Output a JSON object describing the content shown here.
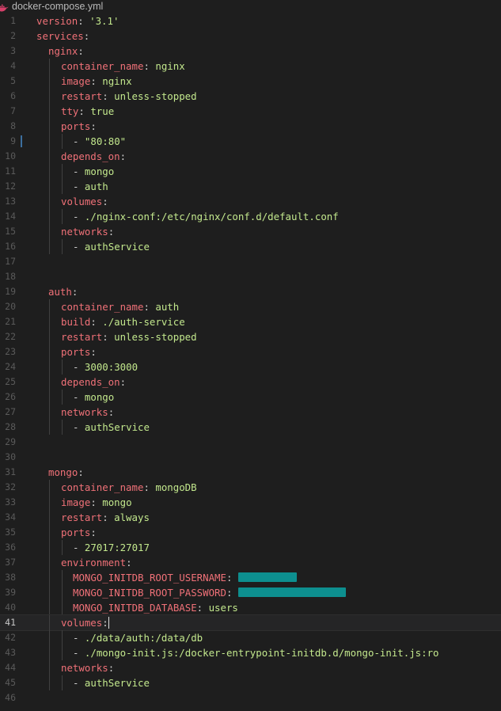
{
  "tab": {
    "filename": "docker-compose.yml",
    "icon": "docker-whale-icon"
  },
  "colors": {
    "key": "#f07178",
    "value": "#c3e88d",
    "redaction": "#0d8f8f",
    "background": "#1e1e1e"
  },
  "editor": {
    "current_line": 41,
    "modified_line": 9
  },
  "lines": [
    {
      "n": "1",
      "indent": 0,
      "key": "version",
      "sep": ": ",
      "val": "'3.1'"
    },
    {
      "n": "2",
      "indent": 0,
      "key": "services",
      "sep": ":",
      "val": ""
    },
    {
      "n": "3",
      "indent": 1,
      "key": "nginx",
      "sep": ":",
      "val": ""
    },
    {
      "n": "4",
      "indent": 2,
      "key": "container_name",
      "sep": ": ",
      "val": "nginx"
    },
    {
      "n": "5",
      "indent": 2,
      "key": "image",
      "sep": ": ",
      "val": "nginx"
    },
    {
      "n": "6",
      "indent": 2,
      "key": "restart",
      "sep": ": ",
      "val": "unless-stopped"
    },
    {
      "n": "7",
      "indent": 2,
      "key": "tty",
      "sep": ": ",
      "val": "true"
    },
    {
      "n": "8",
      "indent": 2,
      "key": "ports",
      "sep": ":",
      "val": ""
    },
    {
      "n": "9",
      "indent": 3,
      "key": "",
      "sep": "- ",
      "val": "\"80:80\""
    },
    {
      "n": "10",
      "indent": 2,
      "key": "depends_on",
      "sep": ":",
      "val": ""
    },
    {
      "n": "11",
      "indent": 3,
      "key": "",
      "sep": "- ",
      "val": "mongo"
    },
    {
      "n": "12",
      "indent": 3,
      "key": "",
      "sep": "- ",
      "val": "auth"
    },
    {
      "n": "13",
      "indent": 2,
      "key": "volumes",
      "sep": ":",
      "val": ""
    },
    {
      "n": "14",
      "indent": 3,
      "key": "",
      "sep": "- ",
      "val": "./nginx-conf:/etc/nginx/conf.d/default.conf"
    },
    {
      "n": "15",
      "indent": 2,
      "key": "networks",
      "sep": ":",
      "val": ""
    },
    {
      "n": "16",
      "indent": 3,
      "key": "",
      "sep": "- ",
      "val": "authService"
    },
    {
      "n": "17",
      "indent": 0,
      "key": "",
      "sep": "",
      "val": ""
    },
    {
      "n": "18",
      "indent": 0,
      "key": "",
      "sep": "",
      "val": ""
    },
    {
      "n": "19",
      "indent": 1,
      "key": "auth",
      "sep": ":",
      "val": ""
    },
    {
      "n": "20",
      "indent": 2,
      "key": "container_name",
      "sep": ": ",
      "val": "auth"
    },
    {
      "n": "21",
      "indent": 2,
      "key": "build",
      "sep": ": ",
      "val": "./auth-service"
    },
    {
      "n": "22",
      "indent": 2,
      "key": "restart",
      "sep": ": ",
      "val": "unless-stopped"
    },
    {
      "n": "23",
      "indent": 2,
      "key": "ports",
      "sep": ":",
      "val": ""
    },
    {
      "n": "24",
      "indent": 3,
      "key": "",
      "sep": "- ",
      "val": "3000:3000"
    },
    {
      "n": "25",
      "indent": 2,
      "key": "depends_on",
      "sep": ":",
      "val": ""
    },
    {
      "n": "26",
      "indent": 3,
      "key": "",
      "sep": "- ",
      "val": "mongo"
    },
    {
      "n": "27",
      "indent": 2,
      "key": "networks",
      "sep": ":",
      "val": ""
    },
    {
      "n": "28",
      "indent": 3,
      "key": "",
      "sep": "- ",
      "val": "authService"
    },
    {
      "n": "29",
      "indent": 0,
      "key": "",
      "sep": "",
      "val": ""
    },
    {
      "n": "30",
      "indent": 0,
      "key": "",
      "sep": "",
      "val": ""
    },
    {
      "n": "31",
      "indent": 1,
      "key": "mongo",
      "sep": ":",
      "val": ""
    },
    {
      "n": "32",
      "indent": 2,
      "key": "container_name",
      "sep": ": ",
      "val": "mongoDB"
    },
    {
      "n": "33",
      "indent": 2,
      "key": "image",
      "sep": ": ",
      "val": "mongo"
    },
    {
      "n": "34",
      "indent": 2,
      "key": "restart",
      "sep": ": ",
      "val": "always"
    },
    {
      "n": "35",
      "indent": 2,
      "key": "ports",
      "sep": ":",
      "val": ""
    },
    {
      "n": "36",
      "indent": 3,
      "key": "",
      "sep": "- ",
      "val": "27017:27017"
    },
    {
      "n": "37",
      "indent": 2,
      "key": "environment",
      "sep": ":",
      "val": ""
    },
    {
      "n": "38",
      "indent": 3,
      "key": "MONGO_INITDB_ROOT_USERNAME",
      "sep": ": ",
      "val": "",
      "redacted": "short"
    },
    {
      "n": "39",
      "indent": 3,
      "key": "MONGO_INITDB_ROOT_PASSWORD",
      "sep": ": ",
      "val": "",
      "redacted": "long"
    },
    {
      "n": "40",
      "indent": 3,
      "key": "MONGO_INITDB_DATABASE",
      "sep": ": ",
      "val": "users"
    },
    {
      "n": "41",
      "indent": 2,
      "key": "volumes",
      "sep": ":",
      "val": ""
    },
    {
      "n": "42",
      "indent": 3,
      "key": "",
      "sep": "- ",
      "val": "./data/auth:/data/db"
    },
    {
      "n": "43",
      "indent": 3,
      "key": "",
      "sep": "- ",
      "val": "./mongo-init.js:/docker-entrypoint-initdb.d/mongo-init.js:ro"
    },
    {
      "n": "44",
      "indent": 2,
      "key": "networks",
      "sep": ":",
      "val": ""
    },
    {
      "n": "45",
      "indent": 3,
      "key": "",
      "sep": "- ",
      "val": "authService"
    },
    {
      "n": "46",
      "indent": 0,
      "key": "",
      "sep": "",
      "val": ""
    }
  ]
}
